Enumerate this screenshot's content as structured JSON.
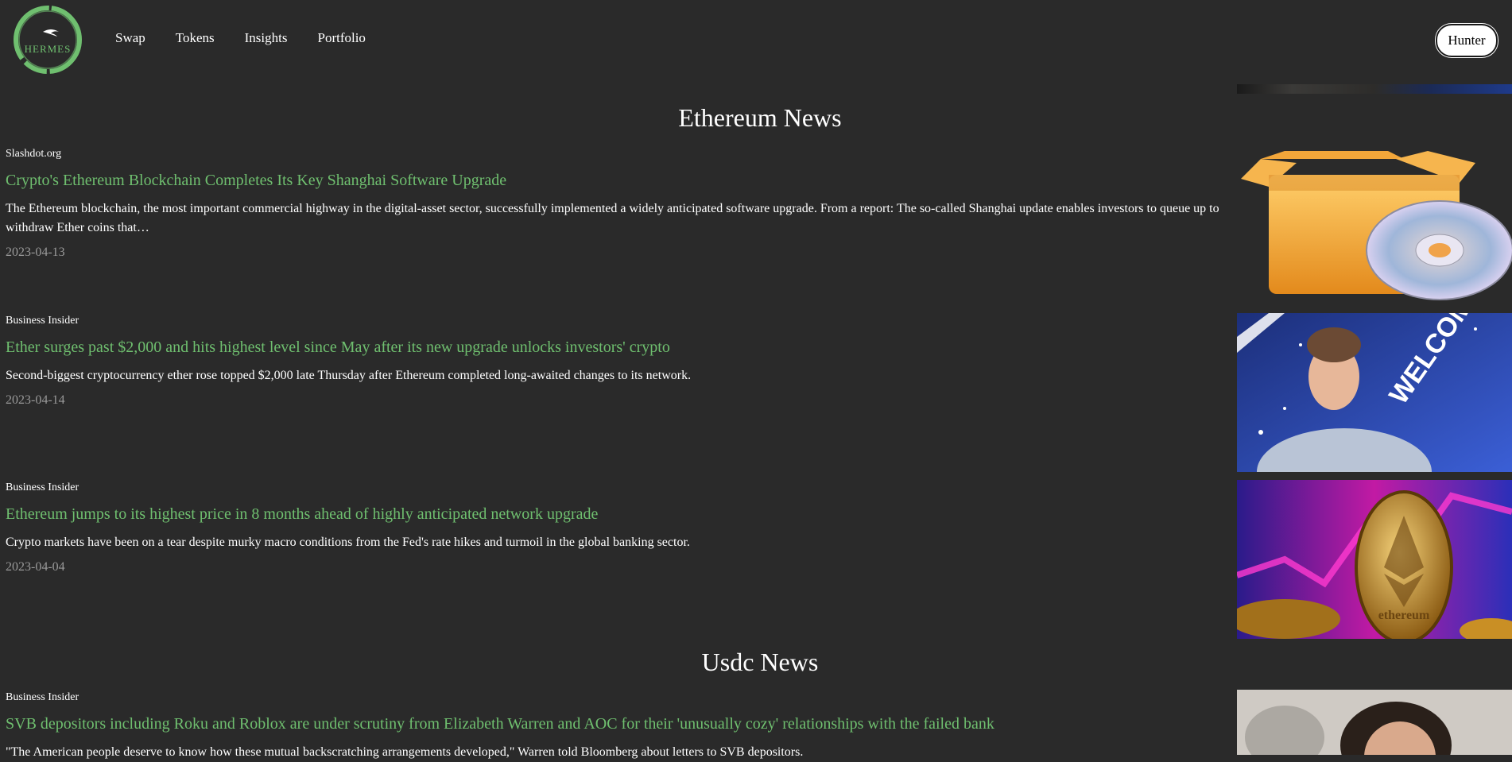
{
  "header": {
    "logo_text": "Hermes",
    "nav": [
      "Swap",
      "Tokens",
      "Insights",
      "Portfolio"
    ],
    "user_label": "Hunter"
  },
  "sections": [
    {
      "title": "Ethereum News",
      "articles": [
        {
          "source": "Slashdot.org",
          "headline": "Crypto's Ethereum Blockchain Completes Its Key Shanghai Software Upgrade",
          "summary": "The Ethereum blockchain, the most important commercial highway in the digital-asset sector, successfully implemented a widely anticipated software upgrade. From a report: The so-called Shanghai update enables investors to queue up to withdraw Ether coins that…",
          "date": "2023-04-13",
          "image": "open-box-with-disc-icon"
        },
        {
          "source": "Business Insider",
          "headline": "Ether surges past $2,000 and hits highest level since May after its new upgrade unlocks investors' crypto",
          "summary": "Second-biggest cryptocurrency ether rose topped $2,000 late Thursday after Ethereum completed long-awaited changes to its network.",
          "date": "2023-04-14",
          "image": "speaker-on-stage-photo"
        },
        {
          "source": "Business Insider",
          "headline": "Ethereum jumps to its highest price in 8 months ahead of highly anticipated network upgrade",
          "summary": "Crypto markets have been on a tear despite murky macro conditions from the Fed's rate hikes and turmoil in the global banking sector.",
          "date": "2023-04-04",
          "image": "ethereum-coin-photo"
        }
      ]
    },
    {
      "title": "Usdc News",
      "articles": [
        {
          "source": "Business Insider",
          "headline": "SVB depositors including Roku and Roblox are under scrutiny from Elizabeth Warren and AOC for their 'unusually cozy' relationships with the failed bank",
          "summary": "\"The American people deserve to know how these mutual backscratching arrangements developed,\" Warren told Bloomberg about letters to SVB depositors.",
          "image": "portrait-photo"
        }
      ]
    }
  ],
  "colors": {
    "background": "#2a2a2a",
    "headline": "#6fbf6f",
    "date": "#9a9a9a",
    "logo_green": "#6fbf6f"
  }
}
